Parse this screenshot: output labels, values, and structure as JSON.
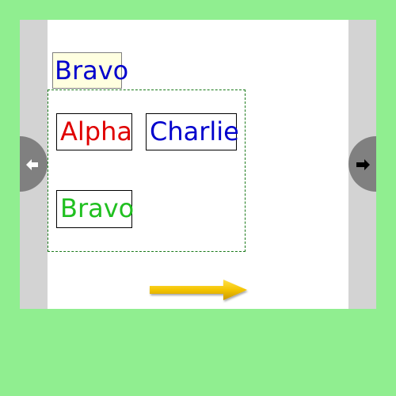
{
  "target": {
    "label": "Bravo",
    "text_color": "#0000cd"
  },
  "cards": [
    {
      "label": "Alpha",
      "text_color": "#e00000"
    },
    {
      "label": "Charlie",
      "text_color": "#0000cd"
    },
    {
      "label": "Bravo",
      "text_color": "#20c020"
    }
  ],
  "icons": {
    "prev": "arrow-left-icon",
    "next": "arrow-right-icon",
    "submit": "yellow-arrow-icon"
  },
  "colors": {
    "background": "#90ee90",
    "panel": "#ffffff",
    "side_bar": "#d3d3d3",
    "nav_button": "#808080",
    "target_fill": "#ffffe0",
    "dropzone_border": "#1a7a1a",
    "arrow": "#f4c400"
  }
}
